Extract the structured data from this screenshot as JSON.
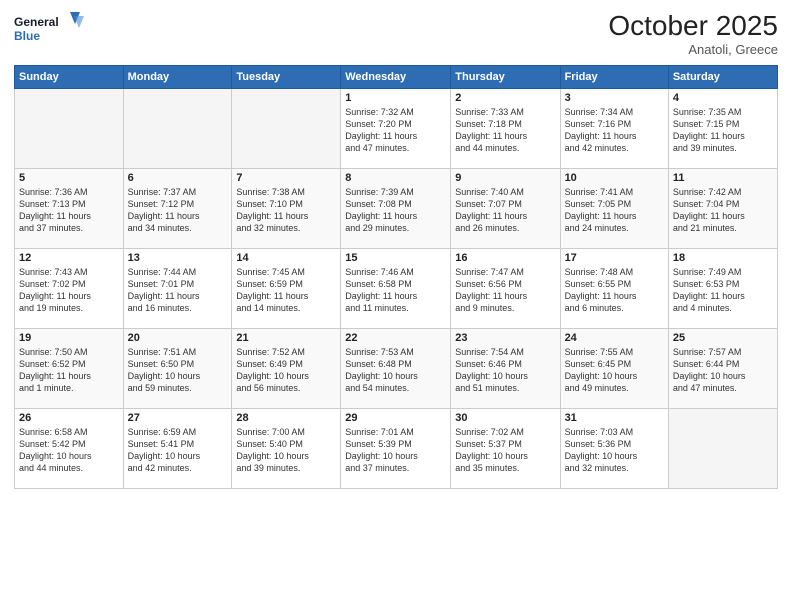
{
  "header": {
    "logo_line1": "General",
    "logo_line2": "Blue",
    "month": "October 2025",
    "location": "Anatoli, Greece"
  },
  "days_of_week": [
    "Sunday",
    "Monday",
    "Tuesday",
    "Wednesday",
    "Thursday",
    "Friday",
    "Saturday"
  ],
  "weeks": [
    [
      {
        "num": "",
        "text": ""
      },
      {
        "num": "",
        "text": ""
      },
      {
        "num": "",
        "text": ""
      },
      {
        "num": "1",
        "text": "Sunrise: 7:32 AM\nSunset: 7:20 PM\nDaylight: 11 hours\nand 47 minutes."
      },
      {
        "num": "2",
        "text": "Sunrise: 7:33 AM\nSunset: 7:18 PM\nDaylight: 11 hours\nand 44 minutes."
      },
      {
        "num": "3",
        "text": "Sunrise: 7:34 AM\nSunset: 7:16 PM\nDaylight: 11 hours\nand 42 minutes."
      },
      {
        "num": "4",
        "text": "Sunrise: 7:35 AM\nSunset: 7:15 PM\nDaylight: 11 hours\nand 39 minutes."
      }
    ],
    [
      {
        "num": "5",
        "text": "Sunrise: 7:36 AM\nSunset: 7:13 PM\nDaylight: 11 hours\nand 37 minutes."
      },
      {
        "num": "6",
        "text": "Sunrise: 7:37 AM\nSunset: 7:12 PM\nDaylight: 11 hours\nand 34 minutes."
      },
      {
        "num": "7",
        "text": "Sunrise: 7:38 AM\nSunset: 7:10 PM\nDaylight: 11 hours\nand 32 minutes."
      },
      {
        "num": "8",
        "text": "Sunrise: 7:39 AM\nSunset: 7:08 PM\nDaylight: 11 hours\nand 29 minutes."
      },
      {
        "num": "9",
        "text": "Sunrise: 7:40 AM\nSunset: 7:07 PM\nDaylight: 11 hours\nand 26 minutes."
      },
      {
        "num": "10",
        "text": "Sunrise: 7:41 AM\nSunset: 7:05 PM\nDaylight: 11 hours\nand 24 minutes."
      },
      {
        "num": "11",
        "text": "Sunrise: 7:42 AM\nSunset: 7:04 PM\nDaylight: 11 hours\nand 21 minutes."
      }
    ],
    [
      {
        "num": "12",
        "text": "Sunrise: 7:43 AM\nSunset: 7:02 PM\nDaylight: 11 hours\nand 19 minutes."
      },
      {
        "num": "13",
        "text": "Sunrise: 7:44 AM\nSunset: 7:01 PM\nDaylight: 11 hours\nand 16 minutes."
      },
      {
        "num": "14",
        "text": "Sunrise: 7:45 AM\nSunset: 6:59 PM\nDaylight: 11 hours\nand 14 minutes."
      },
      {
        "num": "15",
        "text": "Sunrise: 7:46 AM\nSunset: 6:58 PM\nDaylight: 11 hours\nand 11 minutes."
      },
      {
        "num": "16",
        "text": "Sunrise: 7:47 AM\nSunset: 6:56 PM\nDaylight: 11 hours\nand 9 minutes."
      },
      {
        "num": "17",
        "text": "Sunrise: 7:48 AM\nSunset: 6:55 PM\nDaylight: 11 hours\nand 6 minutes."
      },
      {
        "num": "18",
        "text": "Sunrise: 7:49 AM\nSunset: 6:53 PM\nDaylight: 11 hours\nand 4 minutes."
      }
    ],
    [
      {
        "num": "19",
        "text": "Sunrise: 7:50 AM\nSunset: 6:52 PM\nDaylight: 11 hours\nand 1 minute."
      },
      {
        "num": "20",
        "text": "Sunrise: 7:51 AM\nSunset: 6:50 PM\nDaylight: 10 hours\nand 59 minutes."
      },
      {
        "num": "21",
        "text": "Sunrise: 7:52 AM\nSunset: 6:49 PM\nDaylight: 10 hours\nand 56 minutes."
      },
      {
        "num": "22",
        "text": "Sunrise: 7:53 AM\nSunset: 6:48 PM\nDaylight: 10 hours\nand 54 minutes."
      },
      {
        "num": "23",
        "text": "Sunrise: 7:54 AM\nSunset: 6:46 PM\nDaylight: 10 hours\nand 51 minutes."
      },
      {
        "num": "24",
        "text": "Sunrise: 7:55 AM\nSunset: 6:45 PM\nDaylight: 10 hours\nand 49 minutes."
      },
      {
        "num": "25",
        "text": "Sunrise: 7:57 AM\nSunset: 6:44 PM\nDaylight: 10 hours\nand 47 minutes."
      }
    ],
    [
      {
        "num": "26",
        "text": "Sunrise: 6:58 AM\nSunset: 5:42 PM\nDaylight: 10 hours\nand 44 minutes."
      },
      {
        "num": "27",
        "text": "Sunrise: 6:59 AM\nSunset: 5:41 PM\nDaylight: 10 hours\nand 42 minutes."
      },
      {
        "num": "28",
        "text": "Sunrise: 7:00 AM\nSunset: 5:40 PM\nDaylight: 10 hours\nand 39 minutes."
      },
      {
        "num": "29",
        "text": "Sunrise: 7:01 AM\nSunset: 5:39 PM\nDaylight: 10 hours\nand 37 minutes."
      },
      {
        "num": "30",
        "text": "Sunrise: 7:02 AM\nSunset: 5:37 PM\nDaylight: 10 hours\nand 35 minutes."
      },
      {
        "num": "31",
        "text": "Sunrise: 7:03 AM\nSunset: 5:36 PM\nDaylight: 10 hours\nand 32 minutes."
      },
      {
        "num": "",
        "text": ""
      }
    ]
  ]
}
